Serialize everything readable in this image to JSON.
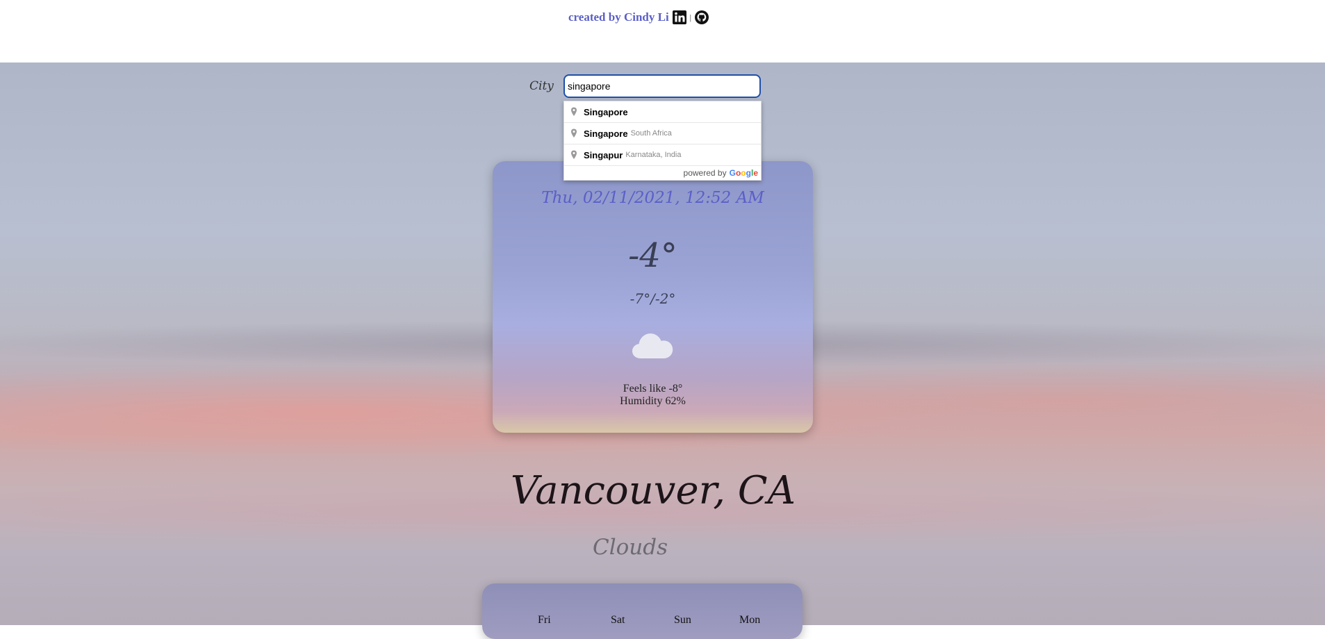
{
  "header": {
    "credit": "created by Cindy Li",
    "separator": "|",
    "linkedin_icon": "linkedin-icon",
    "github_icon": "github-icon"
  },
  "search": {
    "label": "City",
    "value": "singapore",
    "placeholder": ""
  },
  "suggestions": {
    "items": [
      {
        "main": "Singapore",
        "secondary": ""
      },
      {
        "main": "Singapore",
        "secondary": "South Africa"
      },
      {
        "main": "Singapur",
        "secondary": "Karnataka, India"
      }
    ],
    "powered_by": "powered by",
    "google": [
      "G",
      "o",
      "o",
      "g",
      "l",
      "e"
    ],
    "google_colors": [
      "#4285F4",
      "#EA4335",
      "#FBBC05",
      "#4285F4",
      "#34A853",
      "#EA4335"
    ]
  },
  "weather": {
    "datetime": "Thu, 02/11/2021, 12:52 AM",
    "temperature": "-4°",
    "min_max": "-7°/-2°",
    "icon": "cloud-icon",
    "feels_like": "Feels like -8°",
    "humidity": "Humidity 62%",
    "location": "Vancouver, CA",
    "condition": "Clouds"
  },
  "forecast": {
    "days": [
      "Fri",
      "Sat",
      "Sun",
      "Mon"
    ]
  },
  "colors": {
    "accent": "#5a5fc8",
    "input_border": "#1f4fa8"
  }
}
